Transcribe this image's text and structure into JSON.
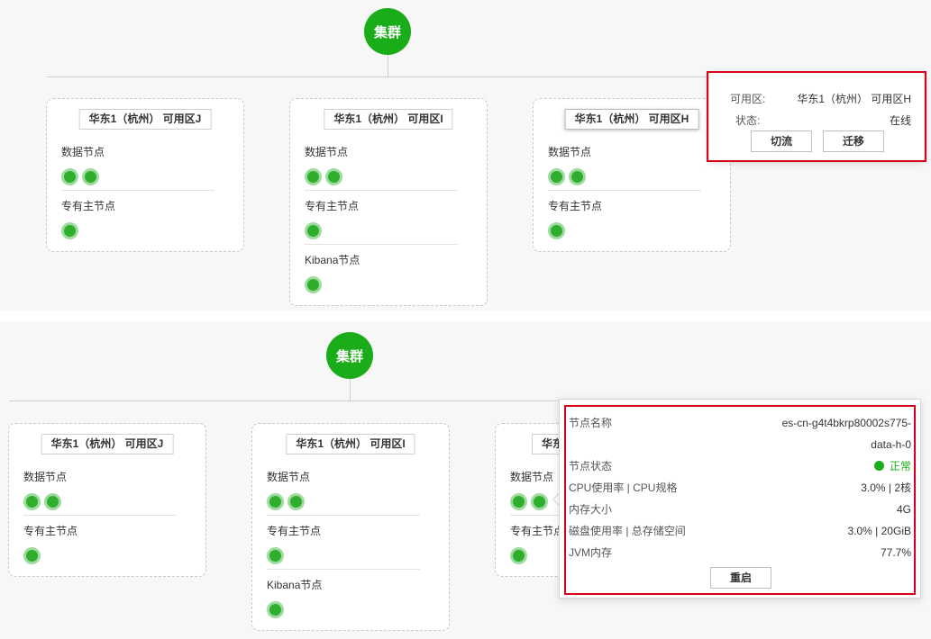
{
  "top": {
    "cluster_label": "集群",
    "zones": [
      {
        "title": "华东1（杭州） 可用区J",
        "sections": [
          "数据节点",
          "专有主节点"
        ],
        "dot_counts": [
          2,
          1
        ]
      },
      {
        "title": "华东1（杭州） 可用区I",
        "sections": [
          "数据节点",
          "专有主节点",
          "Kibana节点"
        ],
        "dot_counts": [
          2,
          1,
          1
        ]
      },
      {
        "title": "华东1（杭州） 可用区H",
        "sections": [
          "数据节点",
          "专有主节点"
        ],
        "dot_counts": [
          2,
          1
        ]
      }
    ],
    "zone_popover": {
      "zone_label": "可用区:",
      "zone_value": "华东1（杭州） 可用区H",
      "status_label": "状态:",
      "status_value": "在线",
      "switch_button": "切流",
      "migrate_button": "迁移"
    }
  },
  "bottom": {
    "cluster_label": "集群",
    "zones": [
      {
        "title": "华东1（杭州） 可用区J",
        "sections": [
          "数据节点",
          "专有主节点"
        ],
        "dot_counts": [
          2,
          1
        ]
      },
      {
        "title": "华东1（杭州） 可用区I",
        "sections": [
          "数据节点",
          "专有主节点",
          "Kibana节点"
        ],
        "dot_counts": [
          2,
          1,
          1
        ]
      },
      {
        "title": "华东",
        "sections": [
          "数据节点",
          "专有主节点"
        ],
        "dot_counts": [
          2,
          1
        ]
      }
    ],
    "node_popover": {
      "name_label": "节点名称",
      "name_value_line1": "es-cn-g4t4bkrp80002s775-",
      "name_value_line2": "data-h-0",
      "status_label": "节点状态",
      "status_value": "正常",
      "cpu_label": "CPU使用率 | CPU规格",
      "cpu_value": "3.0% | 2核",
      "memory_label": "内存大小",
      "memory_value": "4G",
      "disk_label": "磁盘使用率 | 总存储空间",
      "disk_value": "3.0% | 20GiB",
      "jvm_label": "JVM内存",
      "jvm_value": "77.7%",
      "restart_button": "重启"
    }
  },
  "colors": {
    "accent": "#1aad19",
    "node_dot": "#2fae2e",
    "node_ring": "#9fdb9e",
    "highlight": "#d9001b"
  }
}
